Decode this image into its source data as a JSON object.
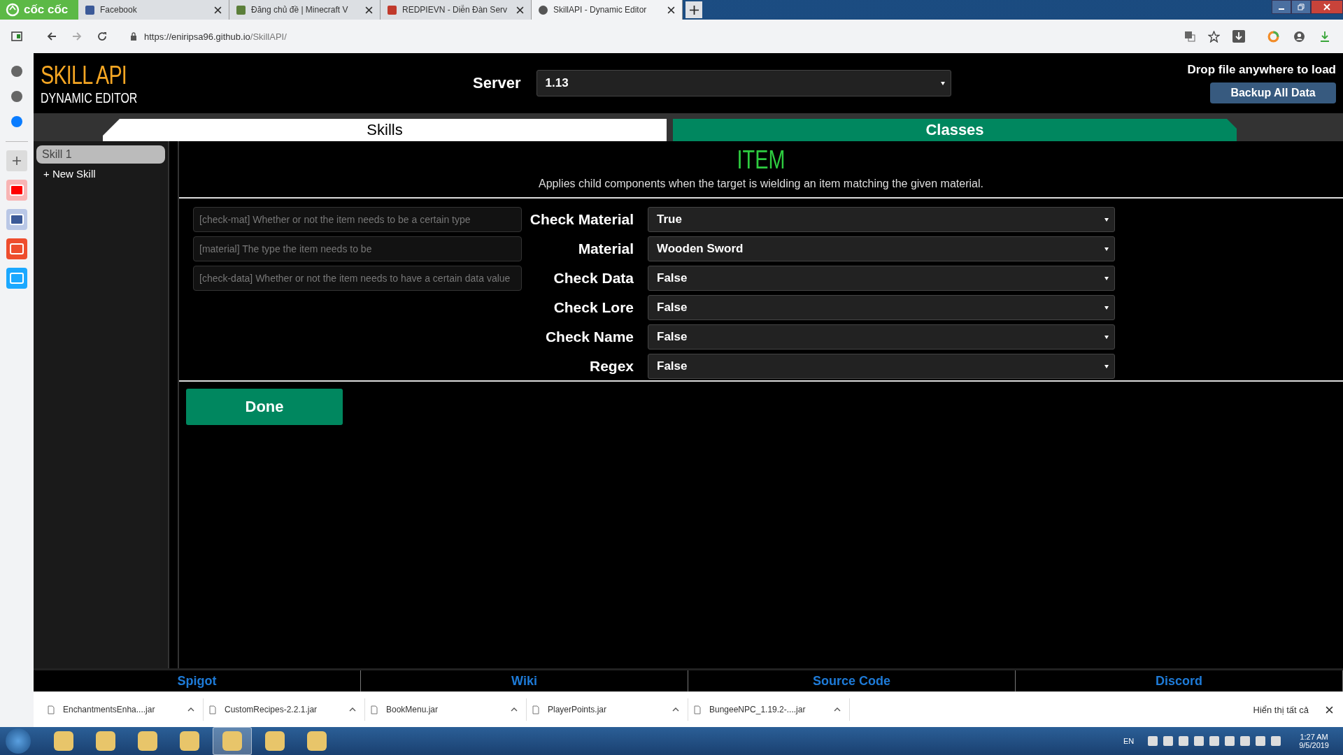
{
  "browser": {
    "brand": "cốc cốc",
    "tabs": [
      {
        "title": "Facebook",
        "selected": false
      },
      {
        "title": "Đăng chủ đề | Minecraft V",
        "selected": false
      },
      {
        "title": "REDPIEVN - Diễn Đàn Serv",
        "selected": false
      },
      {
        "title": "SkillAPI - Dynamic Editor",
        "selected": true
      }
    ],
    "url_host": "https://eniripsa96.github.io",
    "url_path": "/SkillAPI/"
  },
  "header": {
    "title": "SKILL API",
    "subtitle": "DYNAMIC EDITOR",
    "server_label": "Server",
    "server_value": "1.13",
    "drop_hint": "Drop file anywhere to load",
    "backup_button": "Backup All Data"
  },
  "main_tabs": [
    {
      "label": "Skills",
      "selected": true
    },
    {
      "label": "Classes",
      "selected": false
    }
  ],
  "skill_list": {
    "items": [
      {
        "label": "Skill 1",
        "selected": true
      }
    ],
    "new_skill": "+ New Skill"
  },
  "component": {
    "title": "ITEM",
    "description": "Applies child components when the target is wielding an item matching the given material.",
    "tooltips": [
      "[check-mat] Whether or not the item needs to be a certain type",
      "[material] The type the item needs to be",
      "[check-data] Whether or not the item needs to have a certain data value"
    ],
    "fields": [
      {
        "label": "Check Material",
        "value": "True"
      },
      {
        "label": "Material",
        "value": "Wooden Sword"
      },
      {
        "label": "Check Data",
        "value": "False"
      },
      {
        "label": "Check Lore",
        "value": "False"
      },
      {
        "label": "Check Name",
        "value": "False"
      },
      {
        "label": "Regex",
        "value": "False"
      }
    ],
    "done_button": "Done"
  },
  "footer_links": [
    "Spigot",
    "Wiki",
    "Source Code",
    "Discord"
  ],
  "downloads": {
    "items": [
      "EnchantmentsEnha....jar",
      "CustomRecipes-2.2.1.jar",
      "BookMenu.jar",
      "PlayerPoints.jar",
      "BungeeNPC_1.19.2-....jar"
    ],
    "show_all": "Hiển thị tất cả"
  },
  "taskbar": {
    "language": "EN",
    "time": "1:27 AM",
    "date": "9/5/2019"
  }
}
